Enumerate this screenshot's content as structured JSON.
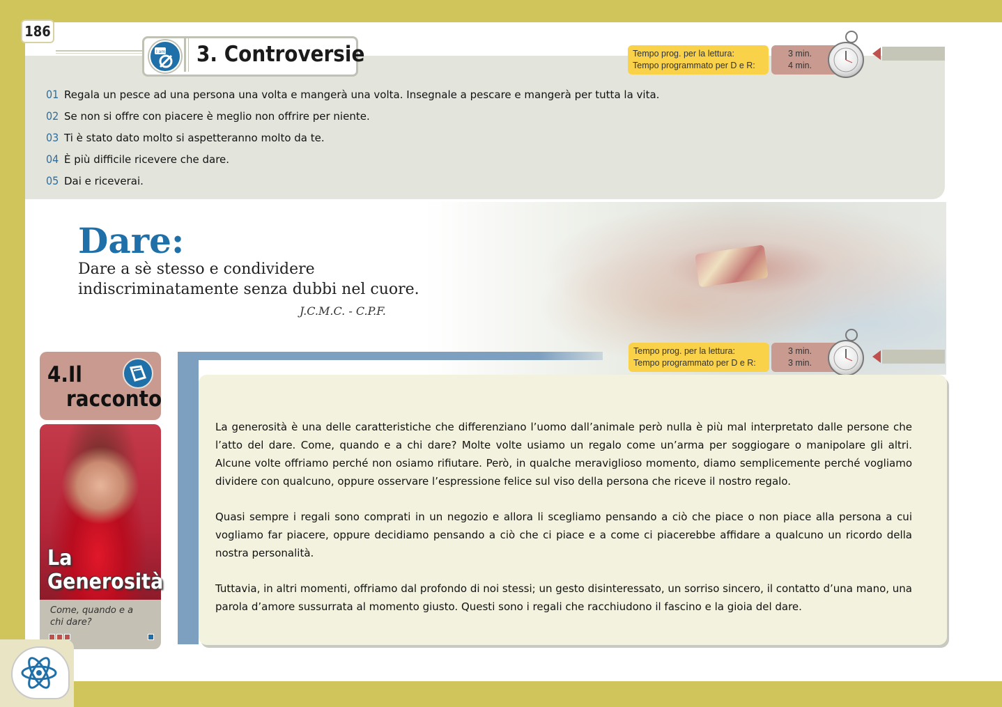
{
  "page_number": "186",
  "section": {
    "title": "3. Controversie",
    "icon_label": "I am...",
    "timer": {
      "labels": [
        "Tempo prog. per la lettura:",
        "Tempo programmato per D e R:"
      ],
      "values": [
        "3 min.",
        "4 min."
      ]
    },
    "items": [
      {
        "num": "01",
        "text": "Regala un pesce ad una persona una volta e mangerà una volta. Insegnale a pescare e mangerà per tutta la vita."
      },
      {
        "num": "02",
        "text": "Se non si offre con piacere è meglio non offrire per niente."
      },
      {
        "num": "03",
        "text": "Ti è stato dato molto si aspetteranno molto da te."
      },
      {
        "num": "04",
        "text": "È più difficile ricevere che dare."
      },
      {
        "num": "05",
        "text": "Dai e riceverai."
      }
    ]
  },
  "quote": {
    "title": "Dare:",
    "text": "Dare a sè stesso e condividere indiscriminatamente senza dubbi nel cuore.",
    "author": "J.C.M.C. - C.P.F."
  },
  "story": {
    "heading_line1": "4.Il",
    "heading_line2": "racconto",
    "timer": {
      "labels": [
        "Tempo prog. per la lettura:",
        "Tempo programmato per D e R:"
      ],
      "values": [
        "3 min.",
        "3 min."
      ]
    },
    "card_title_line1": "La",
    "card_title_line2": "Generosità",
    "card_question": "Come, quando e a chi dare?",
    "paragraphs": [
      "La generosità è una delle caratteristiche che differenziano l’uomo dall’animale però nulla è più mal interpretato dalle persone che l’atto del dare. Come, quando e a chi dare? Molte volte usiamo un regalo come un’arma per soggiogare o manipolare gli altri. Alcune volte offriamo perché non osiamo rifiutare. Però, in qualche meraviglioso momento, diamo semplicemente perché vogliamo dividere con qualcuno, oppure osservare l’espressione felice sul viso della persona che riceve il nostro regalo.",
      "Quasi sempre i regali sono comprati in un negozio e allora li scegliamo pensando a ciò che piace o non piace alla persona a cui vogliamo far piacere, oppure decidiamo pensando a ciò che ci piace e a come ci piacerebbe affidare a qualcuno un ricordo della nostra personalità.",
      "Tuttavia, in altri momenti, offriamo dal profondo di noi stessi; un gesto disinteressato, un sorriso sincero, il contatto d’una mano, una parola d’amore sussurrata al momento giusto. Questi sono i regali che racchiudono il fascino e la gioia del dare."
    ]
  },
  "colors": {
    "accent_blue": "#1f6fa8",
    "border_olive": "#cfc55a",
    "timer_yellow": "#f9d24a",
    "timer_pink": "#c99b90",
    "arrow_red": "#c0504d"
  },
  "icons": [
    "stopwatch-icon",
    "atom-head-logo-icon",
    "book-icon",
    "person-icon"
  ]
}
